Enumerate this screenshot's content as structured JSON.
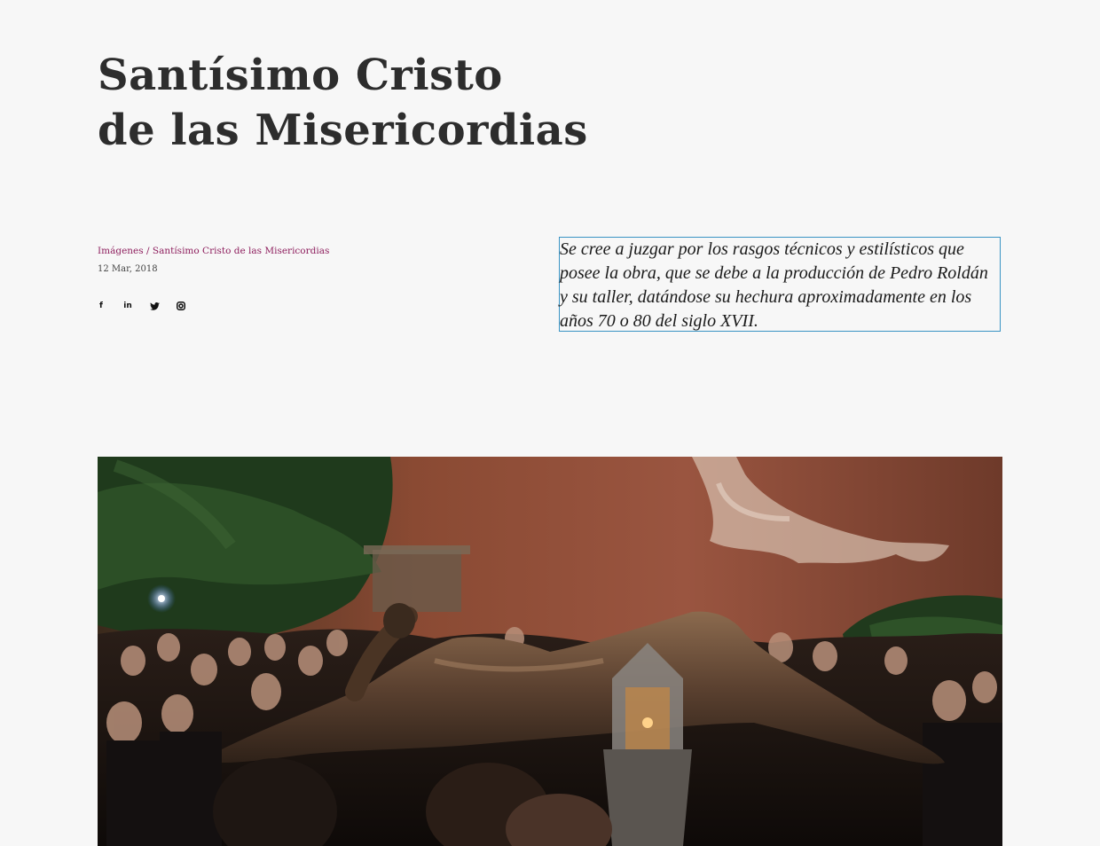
{
  "page": {
    "title_line1": "Santísimo Cristo",
    "title_line2": "de las Misericordias"
  },
  "meta": {
    "breadcrumb_category": "Imágenes",
    "breadcrumb_separator": " / ",
    "breadcrumb_current": "Santísimo Cristo de las Misericordias",
    "date": "12 Mar, 2018",
    "accent_color": "#8e1f5e"
  },
  "social": {
    "icons": [
      "facebook-icon",
      "linkedin-icon",
      "twitter-icon",
      "instagram-icon"
    ],
    "facebook_glyph": "f",
    "linkedin_glyph": "in"
  },
  "excerpt": {
    "text": "Se cree a juzgar por los rasgos técnicos y estilísticos que posee la obra, que se debe a la producción de Pedro Roldán y su taller, datándose su hechura aproximadamente en los años 70 o 80 del siglo XVII."
  }
}
